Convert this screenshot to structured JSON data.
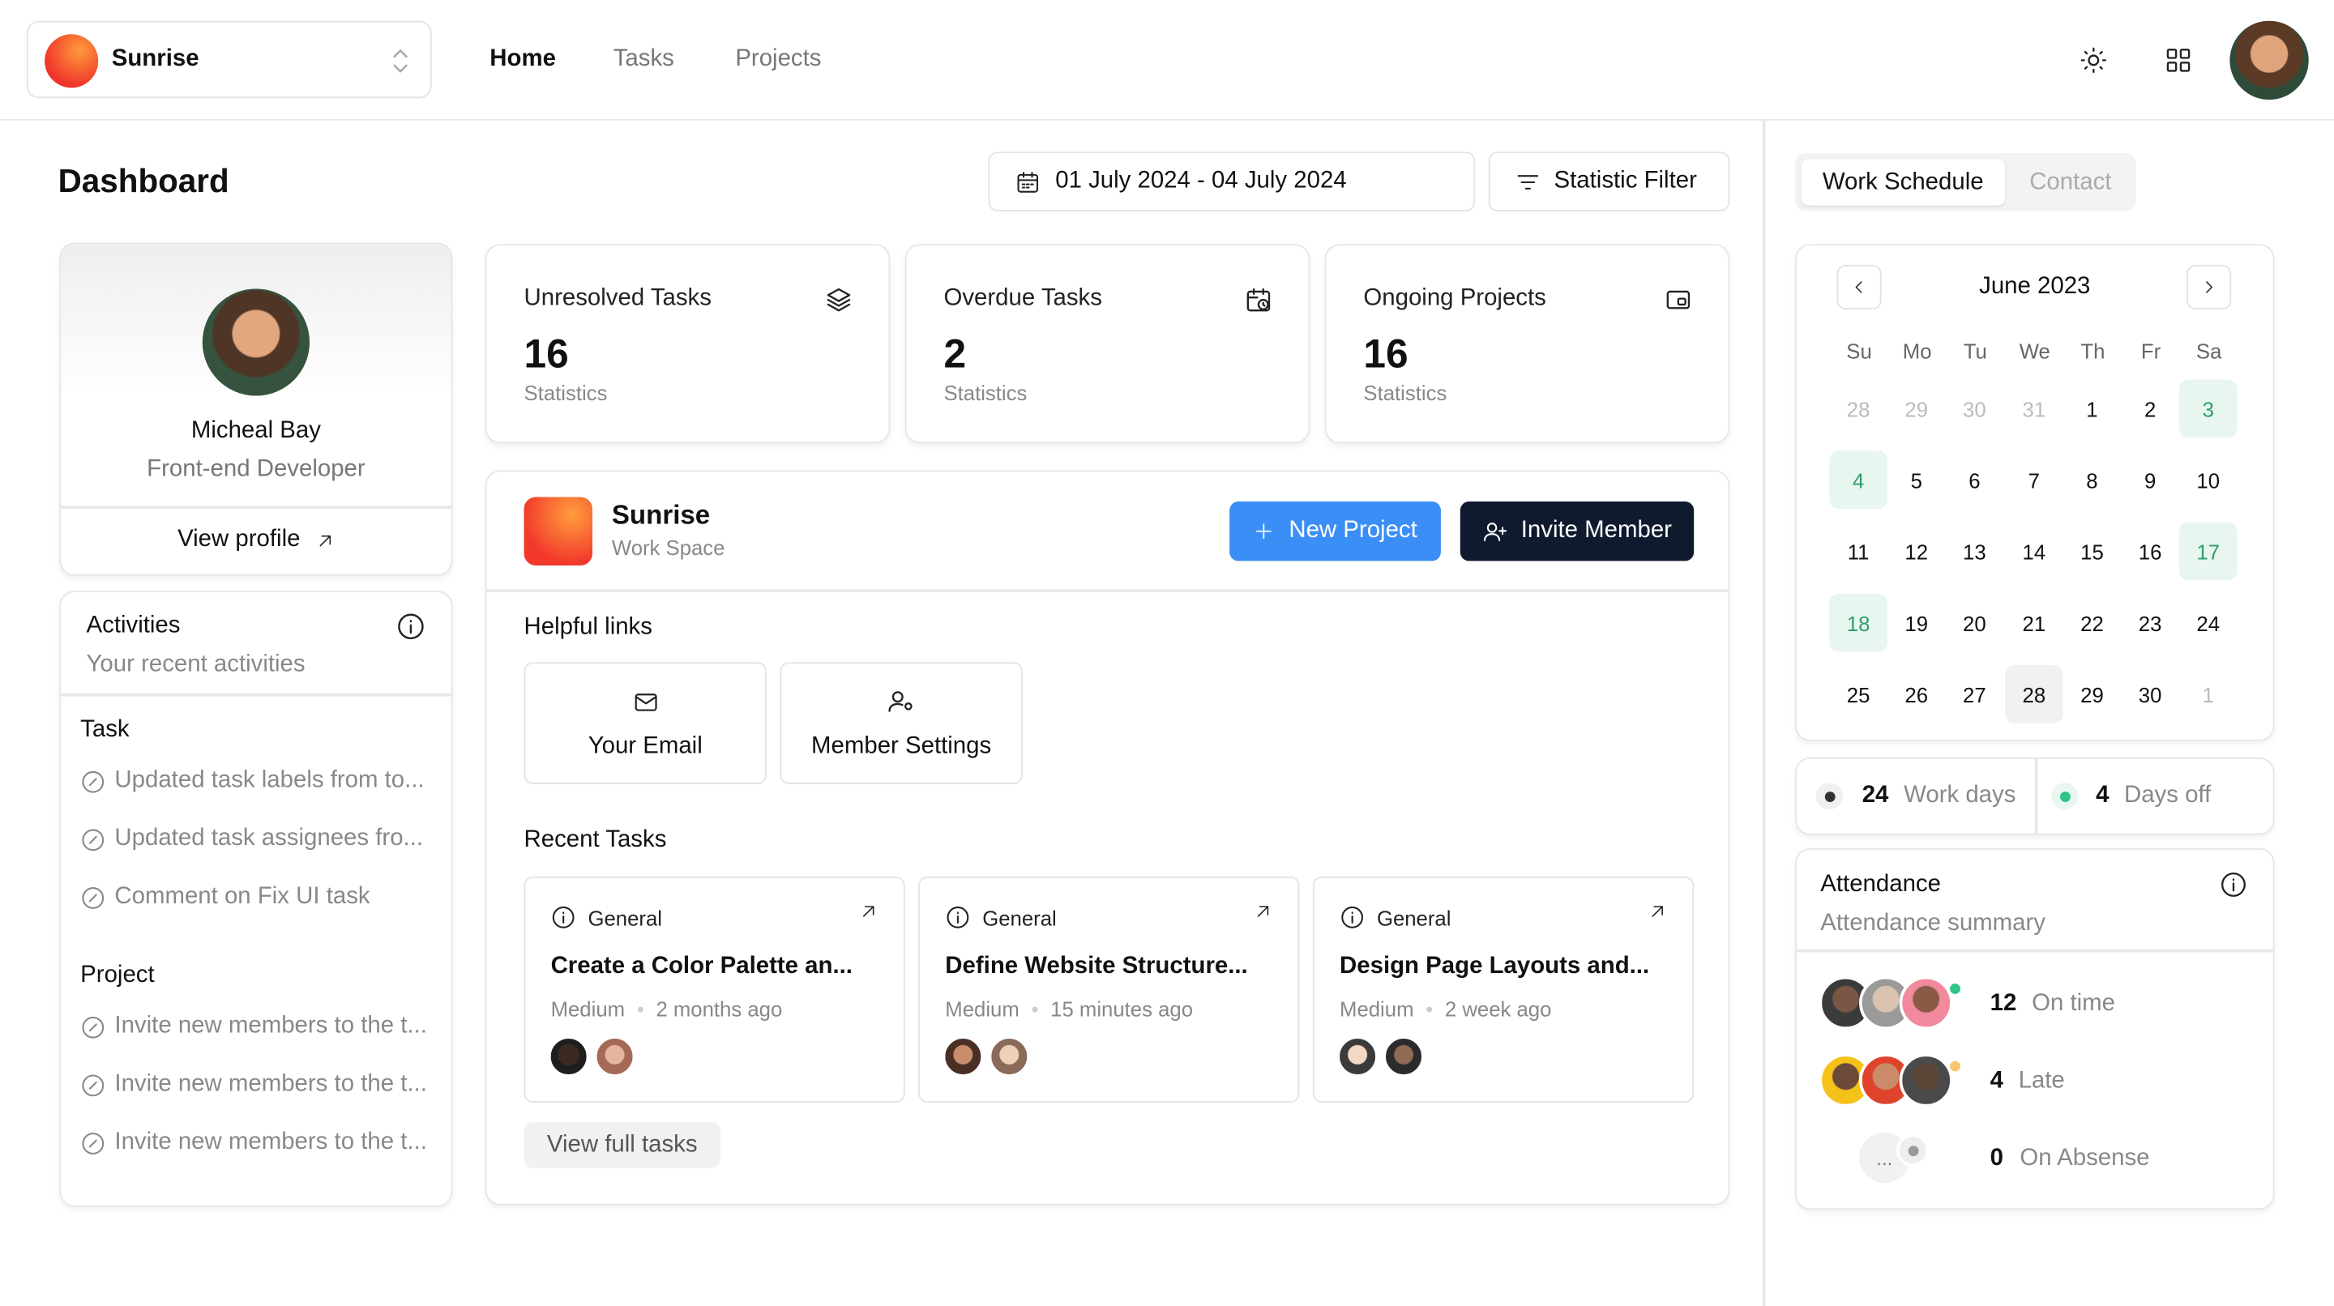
{
  "workspace_switcher": {
    "name": "Sunrise"
  },
  "nav": {
    "home": "Home",
    "tasks": "Tasks",
    "projects": "Projects"
  },
  "page": {
    "title": "Dashboard"
  },
  "date_range": {
    "value": "01 July 2024 - 04 July 2024"
  },
  "filter": {
    "label": "Statistic Filter"
  },
  "profile": {
    "name": "Micheal Bay",
    "role": "Front-end Developer",
    "view_label": "View profile"
  },
  "stats": [
    {
      "title": "Unresolved Tasks",
      "value": "16",
      "sub": "Statistics",
      "icon": "layers-icon"
    },
    {
      "title": "Overdue Tasks",
      "value": "2",
      "sub": "Statistics",
      "icon": "calendar-clock-icon"
    },
    {
      "title": "Ongoing Projects",
      "value": "16",
      "sub": "Statistics",
      "icon": "folder-icon"
    }
  ],
  "activities": {
    "title": "Activities",
    "subtitle": "Your recent activities",
    "task_heading": "Task",
    "task_items": [
      "Updated task labels from to...",
      "Updated task assignees fro...",
      "Comment on Fix UI task"
    ],
    "project_heading": "Project",
    "project_items": [
      "Invite new members to the t...",
      "Invite new members to the t...",
      "Invite new members to the t..."
    ]
  },
  "workspace": {
    "name": "Sunrise",
    "type": "Work Space",
    "new_project": "New Project",
    "invite_member": "Invite Member",
    "helpful_links": "Helpful links",
    "links": [
      "Your Email",
      "Member Settings"
    ],
    "recent_tasks": "Recent Tasks",
    "tasks": [
      {
        "category": "General",
        "title": "Create a Color Palette an...",
        "priority": "Medium",
        "time": "2 months ago"
      },
      {
        "category": "General",
        "title": "Define Website Structure...",
        "priority": "Medium",
        "time": "15 minutes ago"
      },
      {
        "category": "General",
        "title": "Design Page Layouts and...",
        "priority": "Medium",
        "time": "2 week ago"
      }
    ],
    "view_full": "View full tasks"
  },
  "right_tabs": [
    "Work Schedule",
    "Contact"
  ],
  "calendar": {
    "month": "June 2023",
    "dow": [
      "Su",
      "Mo",
      "Tu",
      "We",
      "Th",
      "Fr",
      "Sa"
    ],
    "weeks": [
      [
        "28",
        "29",
        "30",
        "31",
        "1",
        "2",
        "3"
      ],
      [
        "4",
        "5",
        "6",
        "7",
        "8",
        "9",
        "10"
      ],
      [
        "11",
        "12",
        "13",
        "14",
        "15",
        "16",
        "17"
      ],
      [
        "18",
        "19",
        "20",
        "21",
        "22",
        "23",
        "24"
      ],
      [
        "25",
        "26",
        "27",
        "28",
        "29",
        "30",
        "1"
      ]
    ]
  },
  "schedule": {
    "work_days": "24",
    "work_days_label": "Work days",
    "days_off": "4",
    "days_off_label": "Days off"
  },
  "attendance": {
    "title": "Attendance",
    "subtitle": "Attendance summary",
    "rows": [
      {
        "count": "12",
        "label": "On time"
      },
      {
        "count": "4",
        "label": "Late"
      },
      {
        "count": "0",
        "label": "On Absense"
      }
    ],
    "more": "...",
    "colors": {
      "on_time": "#2fc48a",
      "late": "#f5c86b",
      "absent": "#9a9a9a"
    }
  },
  "colors": {
    "primary": "#3b8ef5",
    "dark": "#0f1a2e",
    "highlight": "#e8f6ef"
  }
}
